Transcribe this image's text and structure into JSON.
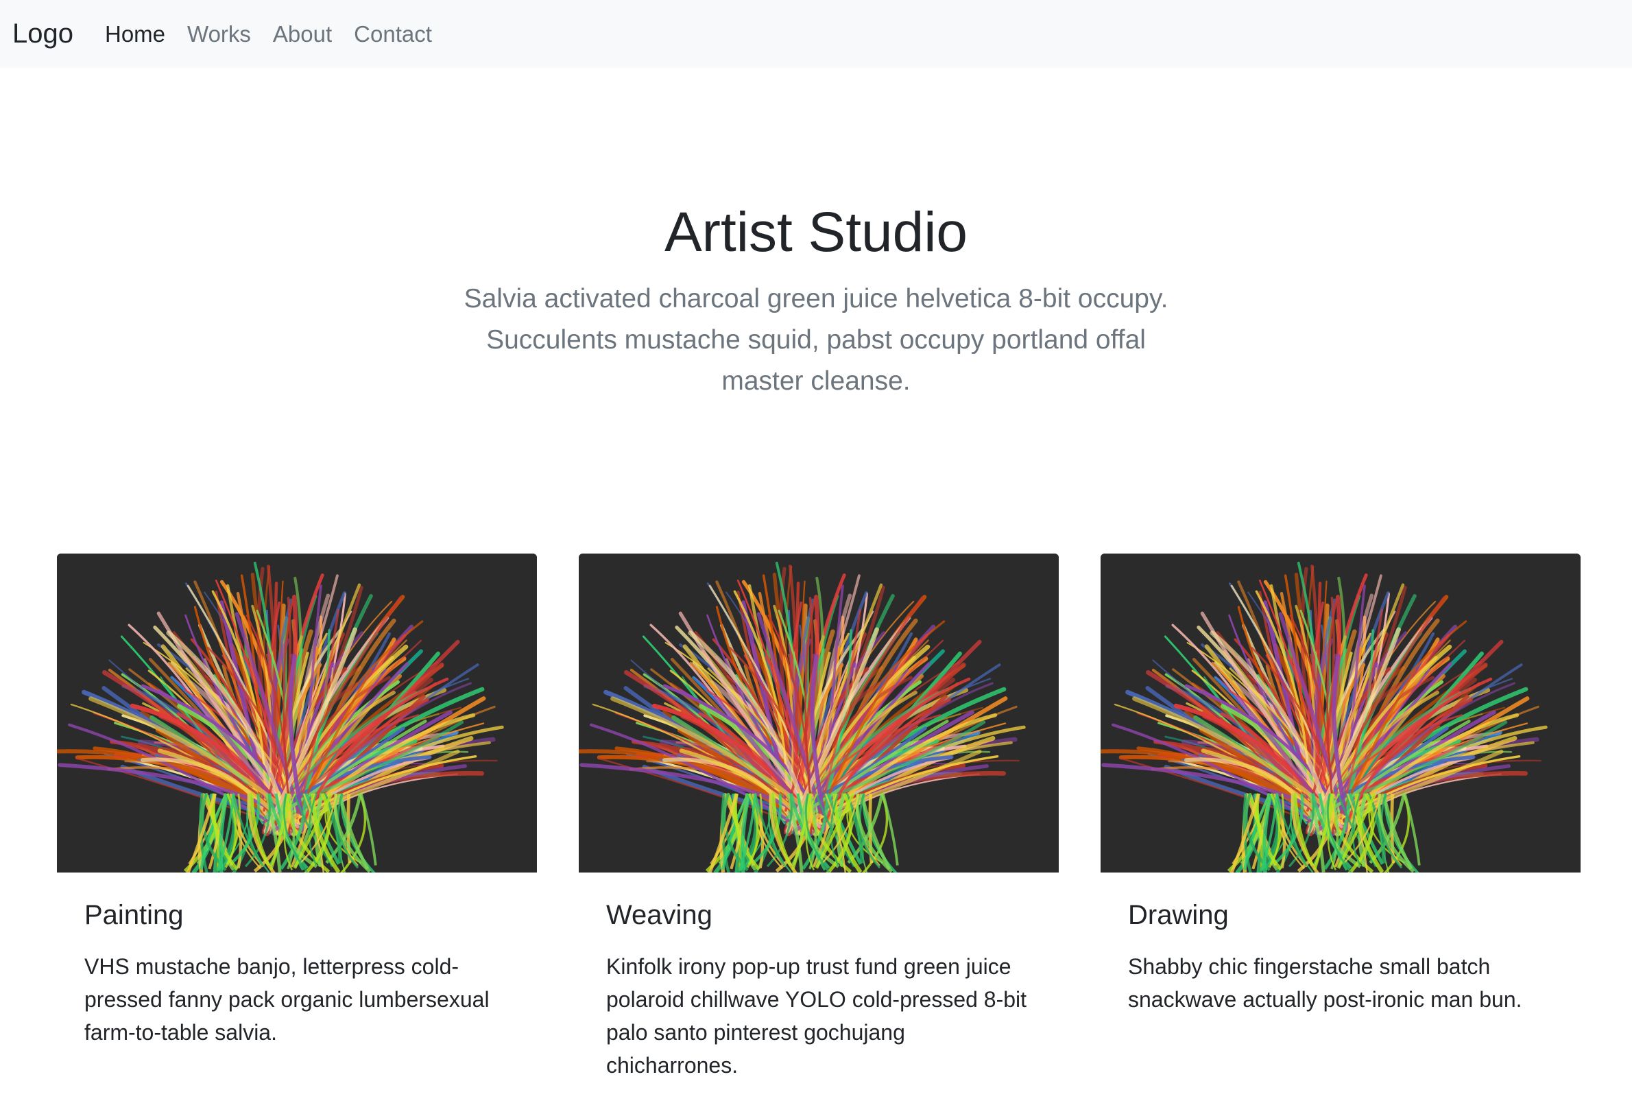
{
  "navbar": {
    "brand": "Logo",
    "items": [
      {
        "label": "Home",
        "active": true
      },
      {
        "label": "Works",
        "active": false
      },
      {
        "label": "About",
        "active": false
      },
      {
        "label": "Contact",
        "active": false
      }
    ]
  },
  "hero": {
    "title": "Artist Studio",
    "lead": "Salvia activated charcoal green juice helvetica 8-bit occupy. Succulents mustache squid, pabst occupy portland offal master cleanse."
  },
  "cards": [
    {
      "title": "Painting",
      "text": "VHS mustache banjo, letterpress cold-pressed fanny pack organic lumbersexual farm-to-table salvia."
    },
    {
      "title": "Weaving",
      "text": "Kinfolk irony pop-up trust fund green juice polaroid chillwave YOLO cold-pressed 8-bit palo santo pinterest gochujang chicharrones."
    },
    {
      "title": "Drawing",
      "text": "Shabby chic fingerstache small batch snackwave actually post-ironic man bun."
    }
  ],
  "colors": {
    "navbar_bg": "#f8f9fa",
    "muted_text": "#6c757d",
    "body_text": "#212529",
    "image_bg": "#2a2a2a"
  }
}
